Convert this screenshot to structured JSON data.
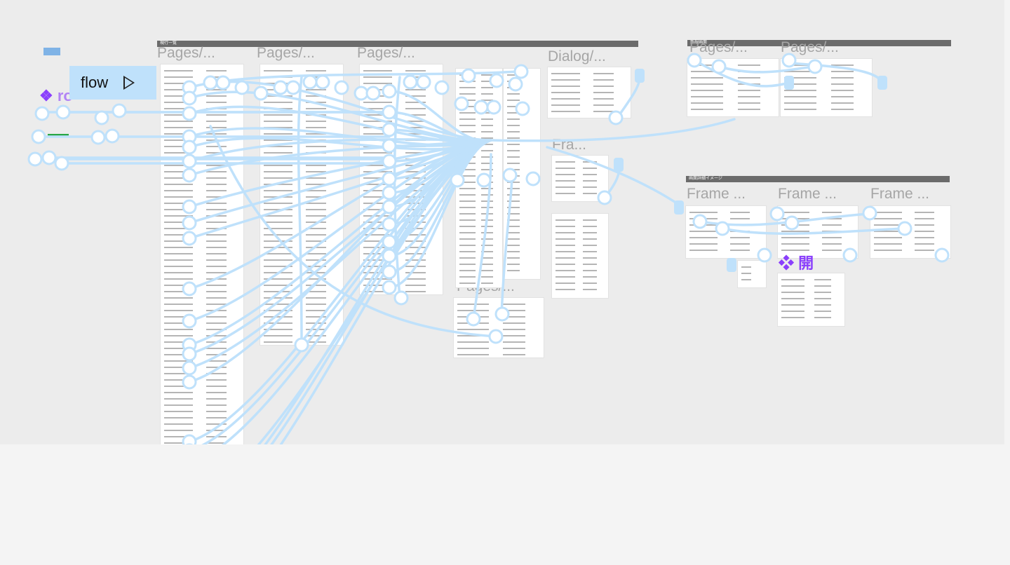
{
  "flow_button": {
    "label": "flow"
  },
  "component_labels": {
    "left": "ro",
    "right": "開"
  },
  "sections": {
    "left": "現行一覧",
    "mid": "新規画面",
    "right": "画面詳細イメージ"
  },
  "frames": {
    "pages_1": "Pages/...",
    "pages_2": "Pages/...",
    "pages_3": "Pages/...",
    "dialog": "Dialog/...",
    "fra": "Fra...",
    "pages_bottom": "Pages/...",
    "right_pages_1": "Pages/...",
    "right_pages_2": "Pages/...",
    "frame_1": "Frame ...",
    "frame_2": "Frame ...",
    "frame_3": "Frame ..."
  },
  "colors": {
    "wire": "#bfe1fb",
    "accent": "#8a3ffc",
    "section": "#6b6b6b"
  }
}
